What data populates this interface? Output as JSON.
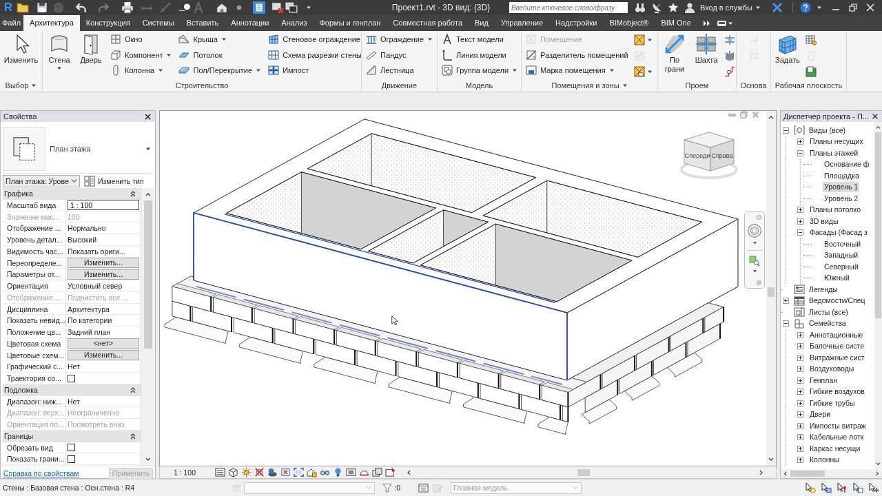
{
  "title_bar": {
    "logo": "R",
    "quick_access": [
      {
        "disabled": false,
        "on": false
      },
      {
        "disabled": false,
        "on": false
      },
      {
        "disabled": true,
        "on": false
      },
      {
        "disabled": false,
        "on": false
      },
      {
        "disabled": true,
        "on": false
      },
      {
        "disabled": false,
        "on": false
      },
      {
        "disabled": true,
        "on": false
      },
      {
        "disabled": true,
        "on": false
      },
      {
        "disabled": false,
        "on": false
      },
      {
        "disabled": true,
        "on": false
      },
      {
        "disabled": false,
        "on": false
      },
      {
        "disabled": false,
        "on": false
      },
      {
        "disabled": false,
        "on": true
      },
      {
        "disabled": false,
        "on": false
      },
      {
        "disabled": false,
        "on": false
      }
    ],
    "title": "Проект1.rvt - 3D вид: {3D}",
    "search": {
      "placeholder": "Введите ключевое слово/фразу"
    },
    "sign_in": "Вход в службы"
  },
  "tabs": [
    {
      "label": "Файл",
      "selected": false
    },
    {
      "label": "Архитектура",
      "selected": true
    },
    {
      "label": "Конструкция",
      "selected": false
    },
    {
      "label": "Системы",
      "selected": false
    },
    {
      "label": "Вставить",
      "selected": false
    },
    {
      "label": "Аннотации",
      "selected": false
    },
    {
      "label": "Анализ",
      "selected": false
    },
    {
      "label": "Формы и генплан",
      "selected": false
    },
    {
      "label": "Совместная работа",
      "selected": false
    },
    {
      "label": "Вид",
      "selected": false
    },
    {
      "label": "Управление",
      "selected": false
    },
    {
      "label": "Надстройки",
      "selected": false
    },
    {
      "label": "BIMobject®",
      "selected": false
    },
    {
      "label": "BIM One",
      "selected": false
    }
  ],
  "ribbon": [
    {
      "title": "Выбор",
      "menu": true,
      "groups": [
        {
          "kind": "large",
          "items": [
            {
              "label": "Изменить",
              "dropdown": false,
              "disabled": false
            }
          ]
        }
      ]
    },
    {
      "title": "Строительство",
      "menu": false,
      "groups": [
        {
          "kind": "large",
          "items": [
            {
              "label": "Стена",
              "dropdown": true,
              "disabled": false
            },
            {
              "label": "Дверь",
              "dropdown": false,
              "disabled": false
            }
          ]
        },
        {
          "kind": "small",
          "items": [
            {
              "label": "Окно",
              "dropdown": false,
              "disabled": false
            },
            {
              "label": "Компонент",
              "dropdown": true,
              "disabled": false
            },
            {
              "label": "Колонна",
              "dropdown": true,
              "disabled": false
            }
          ]
        },
        {
          "kind": "small",
          "items": [
            {
              "label": "Крыша",
              "dropdown": true,
              "disabled": false
            },
            {
              "label": "Потолок",
              "dropdown": false,
              "disabled": false
            },
            {
              "label": "Пол/Перекрытие",
              "dropdown": true,
              "disabled": false
            }
          ]
        },
        {
          "kind": "small",
          "items": [
            {
              "label": "Стеновое ограждение",
              "dropdown": false,
              "disabled": false
            },
            {
              "label": "Схема разрезки стены",
              "dropdown": false,
              "disabled": false
            },
            {
              "label": "Импост",
              "dropdown": false,
              "disabled": false
            }
          ]
        }
      ]
    },
    {
      "title": "Движение",
      "menu": false,
      "groups": [
        {
          "kind": "small",
          "items": [
            {
              "label": "Ограждение",
              "dropdown": true,
              "disabled": false
            },
            {
              "label": "Пандус",
              "dropdown": false,
              "disabled": false
            },
            {
              "label": "Лестница",
              "dropdown": false,
              "disabled": false
            }
          ]
        }
      ]
    },
    {
      "title": "Модель",
      "menu": false,
      "groups": [
        {
          "kind": "small",
          "items": [
            {
              "label": "Текст модели",
              "dropdown": false,
              "disabled": false
            },
            {
              "label": "Линия модели",
              "dropdown": false,
              "disabled": false
            },
            {
              "label": "Группа модели",
              "dropdown": true,
              "disabled": false
            }
          ]
        }
      ]
    },
    {
      "title": "Помещения и зоны",
      "menu": true,
      "groups": [
        {
          "kind": "small",
          "items": [
            {
              "label": "Помещение",
              "dropdown": false,
              "disabled": true
            },
            {
              "label": "Разделитель помещений",
              "dropdown": false,
              "disabled": false
            },
            {
              "label": "Марка помещения",
              "dropdown": true,
              "disabled": false
            }
          ]
        },
        {
          "kind": "icons",
          "items": [
            {
              "dropdown": true,
              "disabled": false
            },
            {
              "dropdown": false,
              "disabled": true
            },
            {
              "dropdown": true,
              "disabled": false
            }
          ]
        }
      ]
    },
    {
      "title": "Проем",
      "menu": false,
      "groups": [
        {
          "kind": "large",
          "items": [
            {
              "label": "По грани",
              "dropdown": false,
              "disabled": false
            },
            {
              "label": "Шахта",
              "dropdown": false,
              "disabled": false
            }
          ]
        },
        {
          "kind": "icons",
          "items": [
            {
              "dropdown": false,
              "disabled": false
            },
            {
              "dropdown": false,
              "disabled": false
            },
            {
              "dropdown": false,
              "disabled": false
            }
          ]
        }
      ]
    },
    {
      "title": "Основа",
      "menu": false,
      "groups": [
        {
          "kind": "icons",
          "items": [
            {
              "dropdown": false,
              "disabled": true
            },
            {
              "dropdown": false,
              "disabled": true
            }
          ]
        }
      ]
    },
    {
      "title": "Рабочая плоскость",
      "menu": false,
      "groups": [
        {
          "kind": "large",
          "items": [
            {
              "label": "Задать",
              "dropdown": false,
              "disabled": false
            }
          ]
        },
        {
          "kind": "icons",
          "items": [
            {
              "dropdown": false,
              "disabled": false
            },
            {
              "dropdown": false,
              "disabled": true
            },
            {
              "dropdown": false,
              "disabled": false
            }
          ]
        }
      ]
    }
  ],
  "properties": {
    "title": "Свойства",
    "type_name": "План этажа",
    "instance": "План этажа: Урове",
    "edit_type": "Изменить тип",
    "groups": [
      {
        "title": "Графика",
        "expanded": true,
        "rows": [
          {
            "name": "Масштаб вида",
            "kind": "input",
            "value": "1 : 100",
            "disabled": false
          },
          {
            "name": "Значение мас...",
            "kind": "text",
            "value": "100",
            "disabled": true
          },
          {
            "name": "Отображение ...",
            "kind": "text",
            "value": "Нормально",
            "disabled": false
          },
          {
            "name": "Уровень детал...",
            "kind": "text",
            "value": "Высокий",
            "disabled": false
          },
          {
            "name": "Видимость час...",
            "kind": "text",
            "value": "Показать ориги...",
            "disabled": false
          },
          {
            "name": "Переопределе...",
            "kind": "button",
            "value": "Изменить...",
            "disabled": false
          },
          {
            "name": "Параметры от...",
            "kind": "button",
            "value": "Изменить...",
            "disabled": false
          },
          {
            "name": "Ориентация",
            "kind": "text",
            "value": "Условный север",
            "disabled": false
          },
          {
            "name": "Отображение ...",
            "kind": "text",
            "value": "Подчистить все ...",
            "disabled": true
          },
          {
            "name": "Дисциплина",
            "kind": "text",
            "value": "Архитектура",
            "disabled": false
          },
          {
            "name": "Показать невид...",
            "kind": "text",
            "value": "По категории",
            "disabled": false
          },
          {
            "name": "Положение цв...",
            "kind": "text",
            "value": "Задний план",
            "disabled": false
          },
          {
            "name": "Цветовая схема",
            "kind": "button",
            "value": "<нет>",
            "disabled": false
          },
          {
            "name": "Цветовые схем...",
            "kind": "button",
            "value": "Изменить...",
            "disabled": false
          },
          {
            "name": "Графический с...",
            "kind": "text",
            "value": "Нет",
            "disabled": false
          },
          {
            "name": "Траектория со...",
            "kind": "checkbox",
            "checked": false,
            "disabled": false
          }
        ]
      },
      {
        "title": "Подложка",
        "expanded": true,
        "rows": [
          {
            "name": "Диапазон: ниж...",
            "kind": "text",
            "value": "Нет",
            "disabled": false
          },
          {
            "name": "Диапазон: верх...",
            "kind": "text",
            "value": "Неограниченно",
            "disabled": true
          },
          {
            "name": "Ориентация по...",
            "kind": "text",
            "value": "Посмотреть вниз",
            "disabled": true
          }
        ]
      },
      {
        "title": "Границы",
        "expanded": true,
        "rows": [
          {
            "name": "Обрезать вид",
            "kind": "checkbox",
            "checked": false,
            "disabled": false
          },
          {
            "name": "Показать грани...",
            "kind": "checkbox",
            "checked": false,
            "disabled": false
          }
        ]
      }
    ],
    "help_link": "Справка по свойствам",
    "apply": {
      "label": "Применить",
      "disabled": true
    }
  },
  "view": {
    "scale": "1 : 100",
    "view_cube": {
      "front": "Спереди",
      "right": "Справа"
    }
  },
  "project_browser": {
    "title": "Диспетчер проекта - П...",
    "tree": [
      {
        "label": "Виды (все)",
        "expanded": true,
        "selected": false,
        "children": [
          {
            "label": "Планы несущих",
            "expanded": false,
            "selected": false
          },
          {
            "label": "Планы этажей",
            "expanded": true,
            "selected": false,
            "children": [
              {
                "label": "Основание ф",
                "selected": false
              },
              {
                "label": "Площадка",
                "selected": false
              },
              {
                "label": "Уровень 1",
                "selected": true
              },
              {
                "label": "Уровень 2",
                "selected": false
              }
            ]
          },
          {
            "label": "Планы потолко",
            "expanded": false,
            "selected": false
          },
          {
            "label": "3D виды",
            "expanded": false,
            "selected": false
          },
          {
            "label": "Фасады (Фасад з",
            "expanded": true,
            "selected": false,
            "children": [
              {
                "label": "Восточный",
                "selected": false
              },
              {
                "label": "Западный",
                "selected": false
              },
              {
                "label": "Северный",
                "selected": false
              },
              {
                "label": "Южный",
                "selected": false
              }
            ]
          }
        ]
      },
      {
        "label": "Легенды",
        "selected": false
      },
      {
        "label": "Ведомости/Спец",
        "expanded": false,
        "selected": false
      },
      {
        "label": "Листы (все)",
        "selected": false
      },
      {
        "label": "Семейства",
        "expanded": true,
        "selected": false,
        "children": [
          {
            "label": "Аннотационные",
            "expanded": false,
            "selected": false
          },
          {
            "label": "Балочные систе",
            "expanded": false,
            "selected": false
          },
          {
            "label": "Витражные сист",
            "expanded": false,
            "selected": false
          },
          {
            "label": "Воздуховоды",
            "expanded": false,
            "selected": false
          },
          {
            "label": "Генплан",
            "expanded": false,
            "selected": false
          },
          {
            "label": "Гибкие воздухов",
            "expanded": false,
            "selected": false
          },
          {
            "label": "Гибкие трубы",
            "expanded": false,
            "selected": false
          },
          {
            "label": "Двери",
            "expanded": false,
            "selected": false
          },
          {
            "label": "Импосты витраж",
            "expanded": false,
            "selected": false
          },
          {
            "label": "Кабельные лотк",
            "expanded": false,
            "selected": false
          },
          {
            "label": "Каркас несущи",
            "expanded": false,
            "selected": false
          },
          {
            "label": "Колонны",
            "expanded": false,
            "selected": false
          }
        ]
      }
    ]
  },
  "status_bar": {
    "selection": "Стены : Базовая стена : Осн.стена : R4",
    "filter_count": ":0",
    "model": {
      "value": "Главная модель",
      "disabled": true
    }
  }
}
